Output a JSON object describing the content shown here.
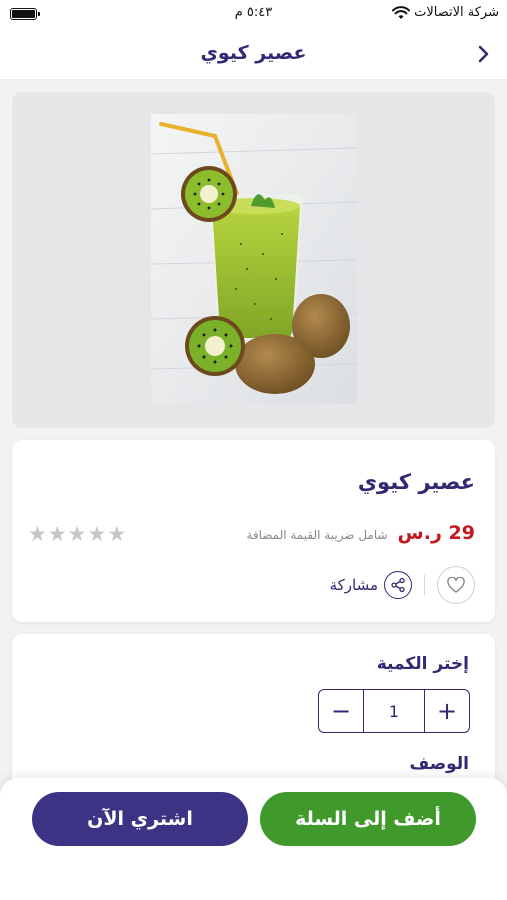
{
  "status_bar": {
    "time": "٥:٤٣ م",
    "carrier": "شركة الاتصالات",
    "icons": [
      "battery-icon",
      "wifi-icon"
    ]
  },
  "header": {
    "title": "عصير كيوي",
    "back_icon": "chevron-right-icon"
  },
  "product": {
    "image": "kiwi-juice-photo",
    "name": "عصير كيوي",
    "price": "29 ر.س",
    "vat_note": "شامل ضريبة القيمة المضافة",
    "rating_stars": 5,
    "rating_filled": 0,
    "share_label": "مشاركة",
    "favorite_icon": "heart-icon",
    "share_icon": "share-icon"
  },
  "quantity": {
    "title": "إختر الكمية",
    "value": "1",
    "increment_icon": "plus-icon",
    "decrement_icon": "minus-icon"
  },
  "description": {
    "title": "الوصف"
  },
  "actions": {
    "add_to_cart_label": "أضف إلى السلة",
    "buy_now_label": "اشتري الآن"
  },
  "colors": {
    "primary": "#2f2a72",
    "buy_button": "#3b3484",
    "cart_button": "#3f9a2b",
    "price": "#c4181f",
    "star_empty": "#c6c6c8",
    "background": "#f2f2f4"
  }
}
